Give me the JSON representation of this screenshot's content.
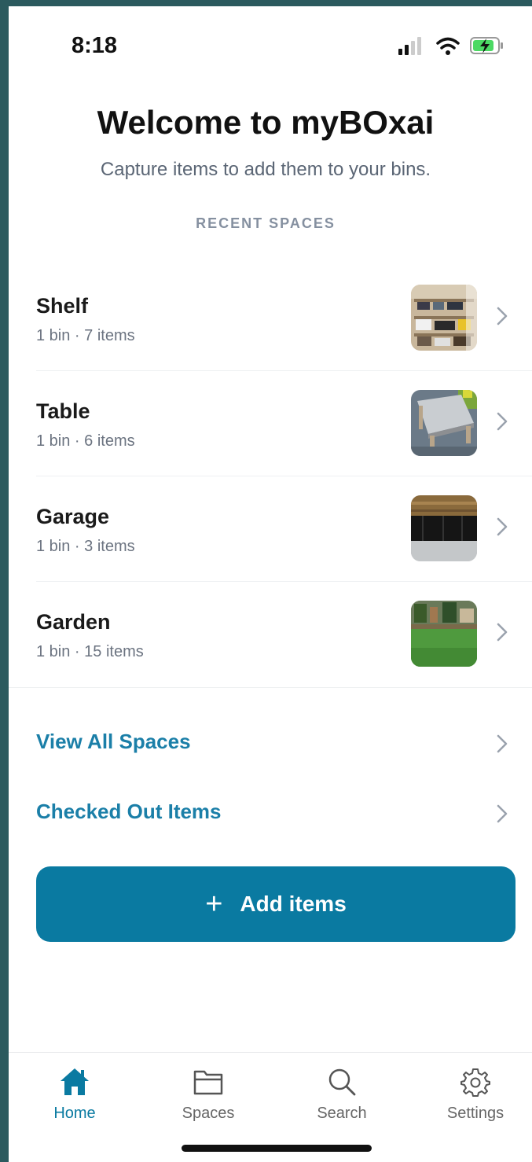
{
  "status": {
    "time": "8:18"
  },
  "header": {
    "title": "Welcome to myBOxai",
    "subtitle": "Capture items to add them to your bins.",
    "section_label": "RECENT SPACES"
  },
  "spaces": [
    {
      "name": "Shelf",
      "meta": "1 bin · 7 items"
    },
    {
      "name": "Table",
      "meta": "1 bin · 6 items"
    },
    {
      "name": "Garage",
      "meta": "1 bin · 3 items"
    },
    {
      "name": "Garden",
      "meta": "1 bin · 15 items"
    }
  ],
  "links": {
    "view_all": "View All Spaces",
    "checked_out": "Checked Out Items"
  },
  "add_button": {
    "plus": "+",
    "label": "Add items"
  },
  "tabs": [
    {
      "label": "Home",
      "icon": "house-icon"
    },
    {
      "label": "Spaces",
      "icon": "folder-icon"
    },
    {
      "label": "Search",
      "icon": "magnifier-icon"
    },
    {
      "label": "Settings",
      "icon": "gear-icon"
    }
  ],
  "colors": {
    "accent": "#0a7aa1",
    "link": "#1b7fa8"
  }
}
